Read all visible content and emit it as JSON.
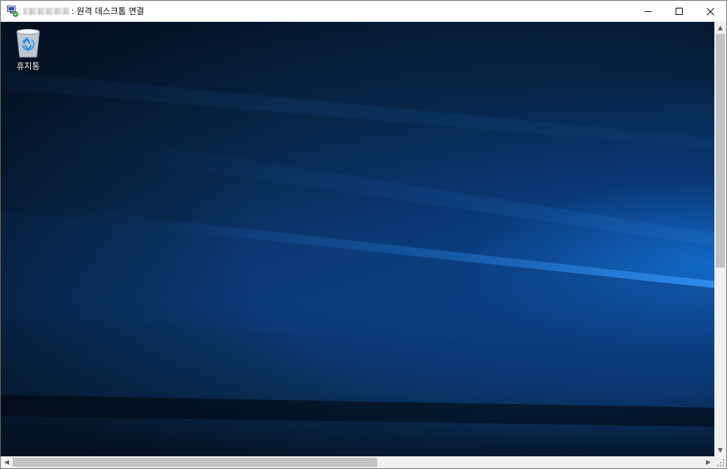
{
  "window": {
    "title_host_redacted": "▒▒▒▒▒▒▒▒",
    "title_text": ": 원격 데스크톱 연결",
    "app_icon": "remote-desktop-icon",
    "controls": {
      "minimize": "minimize-icon",
      "maximize": "maximize-icon",
      "close": "close-icon"
    }
  },
  "desktop": {
    "icons": [
      {
        "label": "휴지통",
        "icon": "recycle-bin-icon"
      }
    ],
    "wallpaper_colors": [
      "#061e3b",
      "#0c3a74",
      "#1a7be0"
    ]
  },
  "scrollbars": {
    "vertical": {
      "up": "▲",
      "down": "▼",
      "position": 0
    },
    "horizontal": {
      "left": "◀",
      "right": "▶",
      "position": 0
    }
  }
}
